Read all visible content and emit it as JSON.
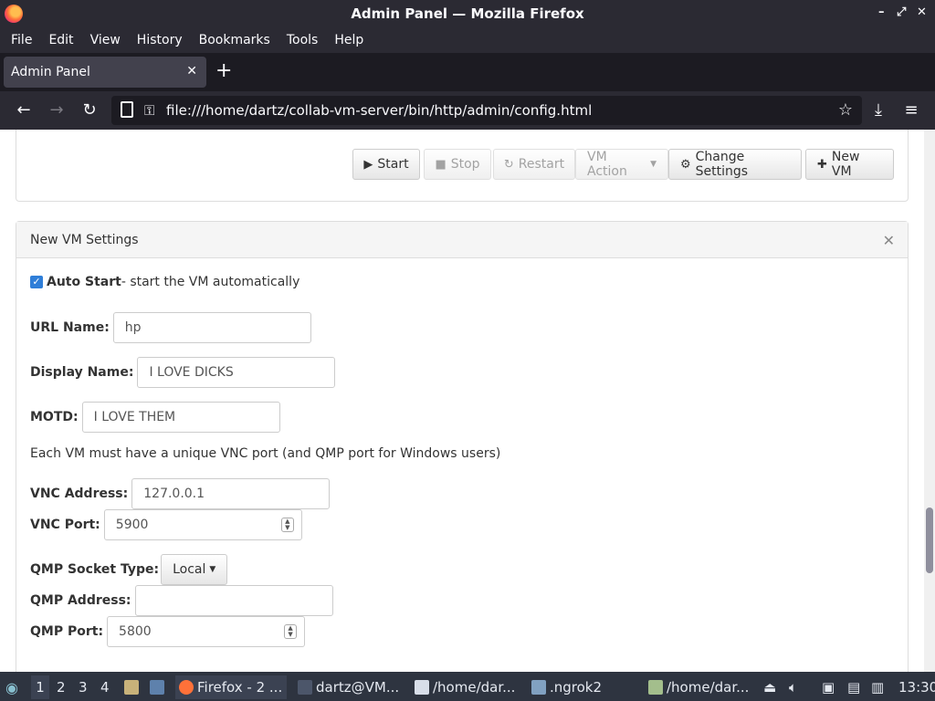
{
  "window": {
    "title": "Admin Panel — Mozilla Firefox",
    "controls": [
      "–",
      "⤢",
      "✕"
    ]
  },
  "menu": [
    "File",
    "Edit",
    "View",
    "History",
    "Bookmarks",
    "Tools",
    "Help"
  ],
  "tabs": [
    {
      "label": "Admin Panel"
    }
  ],
  "nav": {
    "url": "file:///home/dartz/collab-vm-server/bin/http/admin/config.html"
  },
  "toolbar": {
    "start": "Start",
    "stop": "Stop",
    "restart": "Restart",
    "vm_action": "VM Action",
    "change_settings": "Change Settings",
    "new_vm": "New VM"
  },
  "new_vm_panel": {
    "title": "New VM Settings",
    "auto_start_label": "Auto Start",
    "auto_start_desc": " - start the VM automatically",
    "url_name_label": "URL Name:",
    "url_name_value": "hp",
    "display_name_label": "Display Name:",
    "display_name_value": "I LOVE DICKS",
    "motd_label": "MOTD:",
    "motd_value": "I LOVE THEM",
    "vnc_note": "Each VM must have a unique VNC port (and QMP port for Windows users)",
    "vnc_address_label": "VNC Address:",
    "vnc_address_value": "127.0.0.1",
    "vnc_port_label": "VNC Port:",
    "vnc_port_value": "5900",
    "qmp_socket_label": "QMP Socket Type:",
    "qmp_socket_value": "Local",
    "qmp_address_label": "QMP Address:",
    "qmp_address_value": "",
    "qmp_port_label": "QMP Port:",
    "qmp_port_value": "5800"
  },
  "taskbar": {
    "workspaces": [
      "1",
      "2",
      "3",
      "4"
    ],
    "items": [
      "Firefox - 2 ...",
      "dartz@VM...",
      "/home/dar...",
      ".ngrok2",
      "/home/dar..."
    ],
    "clock": "13:30"
  }
}
